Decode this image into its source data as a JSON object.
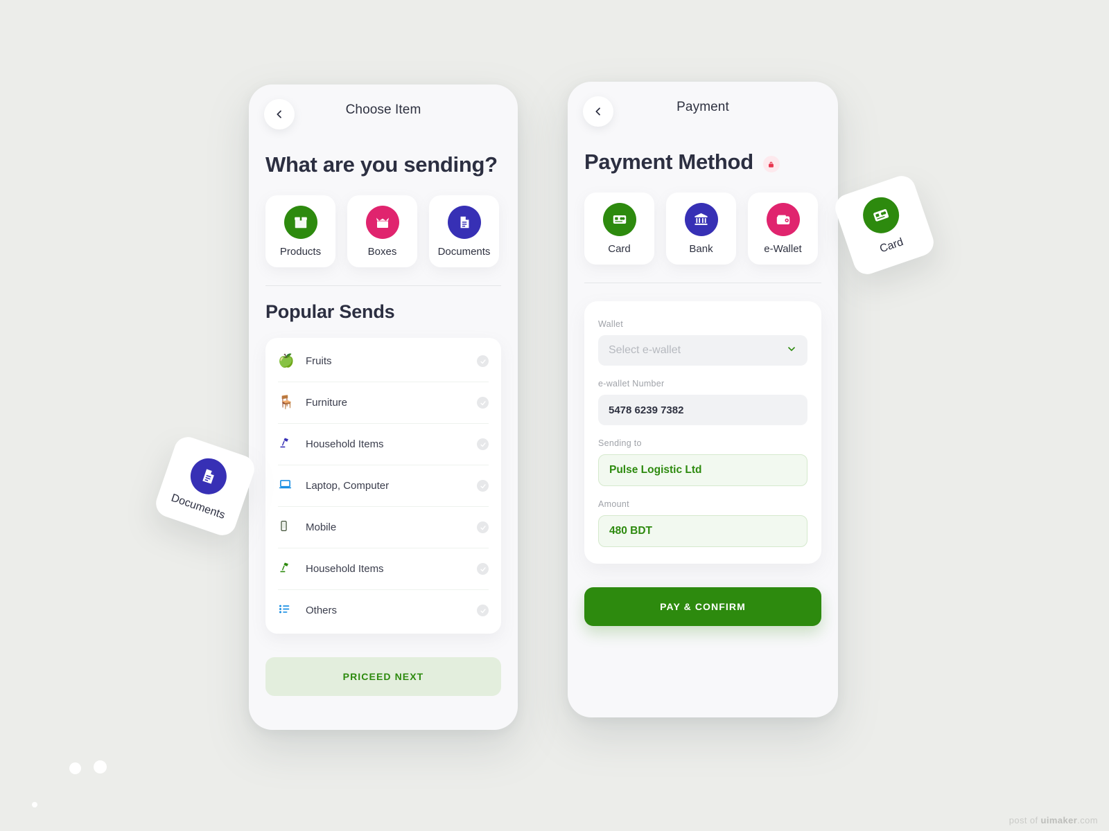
{
  "background": {
    "page": "#ecedea",
    "phone": "#f8f8fa"
  },
  "palette": {
    "green": "#2d8a0e",
    "pink": "#e0246e",
    "indigo": "#3730b5",
    "ink": "#2c2f41"
  },
  "watermark": {
    "prefix": "post of ",
    "brand": "uimaker",
    "suffix": ".com"
  },
  "left_screen": {
    "appbar": {
      "title": "Choose Item",
      "back_icon": "chevron-left-icon"
    },
    "heading": "What are you sending?",
    "tiles": [
      {
        "label": "Products",
        "icon": "package-icon",
        "color": "#2d8a0e"
      },
      {
        "label": "Boxes",
        "icon": "open-box-icon",
        "color": "#e0246e"
      },
      {
        "label": "Documents",
        "icon": "document-icon",
        "color": "#3730b5"
      }
    ],
    "section_title": "Popular Sends",
    "items": [
      {
        "label": "Fruits",
        "icon": "apple-icon",
        "glyph": "🍏",
        "checked": true
      },
      {
        "label": "Furniture",
        "icon": "armchair-icon",
        "glyph": "🪑",
        "checked": true
      },
      {
        "label": "Household Items",
        "icon": "desk-lamp-icon",
        "glyph": "💡",
        "checked": true
      },
      {
        "label": "Laptop, Computer",
        "icon": "laptop-icon",
        "glyph": "💻",
        "checked": true
      },
      {
        "label": "Mobile",
        "icon": "mobile-phone-icon",
        "glyph": "📱",
        "checked": true
      },
      {
        "label": "Household Items",
        "icon": "desk-lamp-icon",
        "glyph": "💡",
        "checked": true
      },
      {
        "label": "Others",
        "icon": "list-icon",
        "glyph": "☰",
        "checked": true
      }
    ],
    "primary_button": "PRICEED NEXT"
  },
  "right_screen": {
    "appbar": {
      "title": "Payment",
      "back_icon": "chevron-left-icon"
    },
    "heading": "Payment Method",
    "heading_badge_icon": "lock-icon",
    "methods": [
      {
        "label": "Card",
        "icon": "credit-card-icon",
        "color": "#2d8a0e"
      },
      {
        "label": "Bank",
        "icon": "bank-icon",
        "color": "#3730b5"
      },
      {
        "label": "e-Wallet",
        "icon": "wallet-icon",
        "color": "#e0246e"
      }
    ],
    "form": {
      "wallet_label": "Wallet",
      "wallet_placeholder": "Select e-wallet",
      "wallet_chevron_icon": "chevron-down-icon",
      "number_label": "e-wallet  Number",
      "number_value": "5478 6239 7382",
      "sending_label": "Sending to",
      "sending_value": "Pulse Logistic Ltd",
      "amount_label": "Amount",
      "amount_value": "480 BDT"
    },
    "primary_button": "PAY & CONFIRM"
  },
  "floating_cards": [
    {
      "label": "Documents",
      "icon": "document-icon",
      "color": "#3730b5"
    },
    {
      "label": "Card",
      "icon": "credit-card-icon",
      "color": "#2d8a0e"
    }
  ]
}
